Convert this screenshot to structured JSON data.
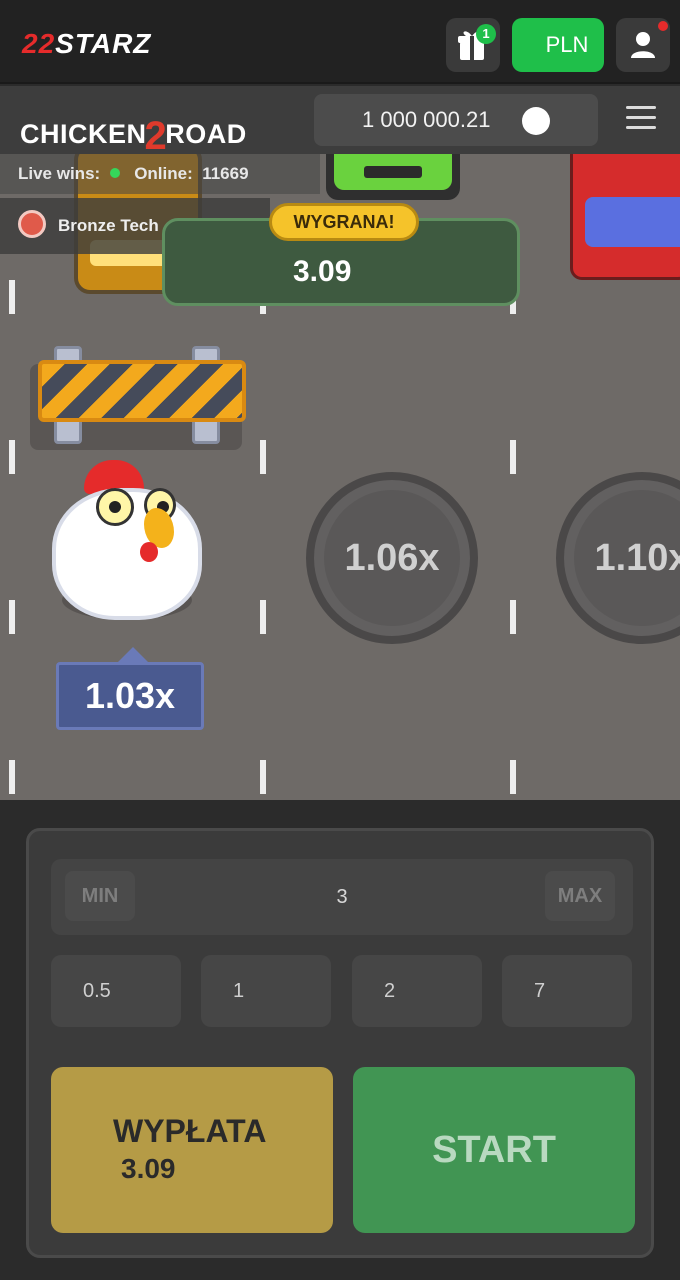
{
  "topbar": {
    "brand_mark": "22",
    "brand_name": "STARZ",
    "gift_badge": "1",
    "currency": "PLN"
  },
  "game_header": {
    "logo_left": "CHICKEN",
    "logo_num": "2",
    "logo_right": "ROAD",
    "balance": "1 000 000.21"
  },
  "live": {
    "wins_label": "Live wins:",
    "online_label": "Online:",
    "online_count": "11669",
    "winner_name": "Bronze Tech"
  },
  "win_popup": {
    "title": "WYGRANA!",
    "amount": "3.09"
  },
  "lanes": {
    "current_multiplier": "1.03x",
    "next_multipliers": [
      "1.06x",
      "1.10x"
    ]
  },
  "controls": {
    "min_label": "MIN",
    "max_label": "MAX",
    "bet_value": "3",
    "quick_bets": [
      "0.5",
      "1",
      "2",
      "7"
    ],
    "cashout_label": "WYPŁATA",
    "cashout_value": "3.09",
    "start_label": "START"
  },
  "colors": {
    "accent_green": "#1fbf4a",
    "cashout": "#b59b46",
    "start": "#419553",
    "win_badge": "#f5c32a"
  },
  "icons": {
    "gift": "gift-icon",
    "user": "user-icon",
    "menu": "hamburger-menu-icon",
    "coin": "coin-icon"
  }
}
